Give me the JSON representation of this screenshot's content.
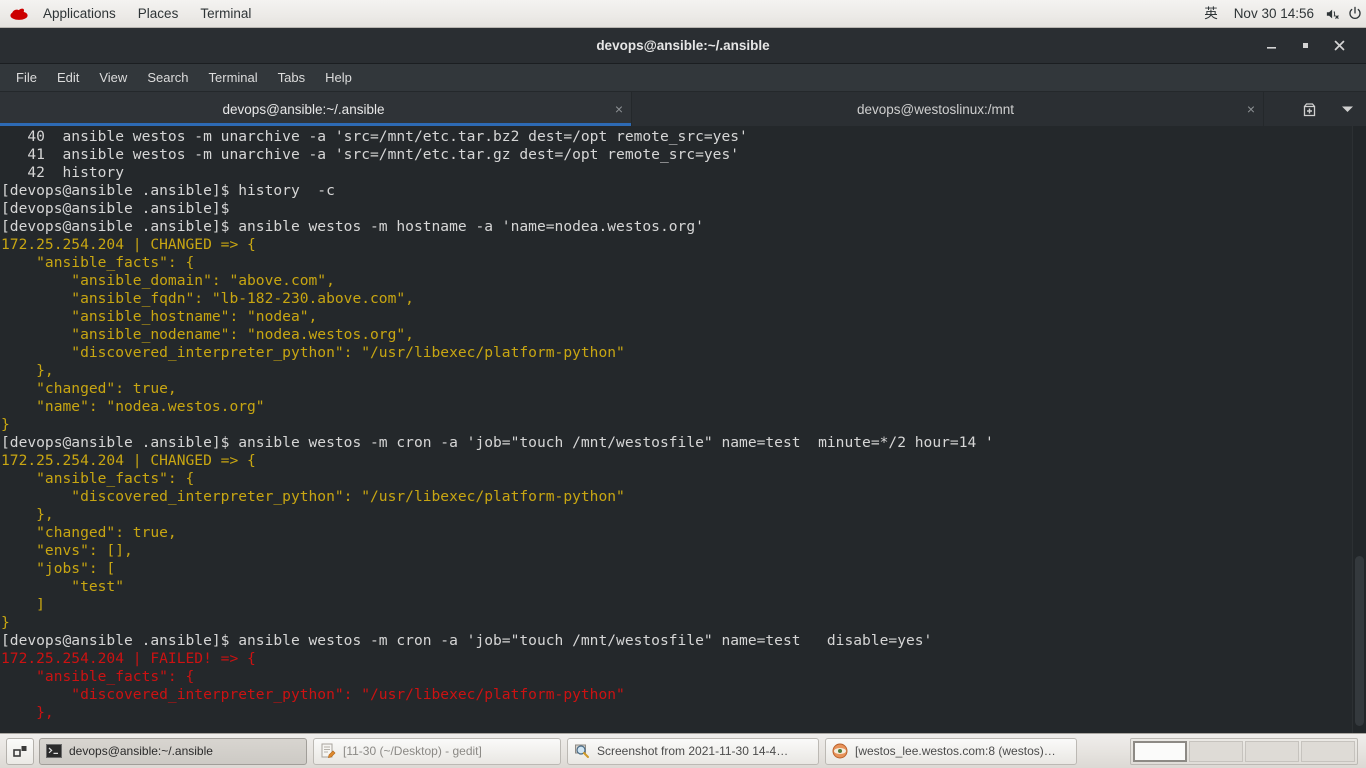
{
  "top_panel": {
    "logo": "redhat-logo",
    "menus": [
      "Applications",
      "Places",
      "Terminal"
    ],
    "input_method": "英",
    "clock": "Nov 30  14:56",
    "volume_icon": "speaker-muted-icon",
    "power_icon": "power-icon"
  },
  "window": {
    "title": "devops@ansible:~/.ansible",
    "controls": {
      "minimize": "minimize-icon",
      "maximize": "maximize-icon",
      "close": "close-icon"
    },
    "menubar": [
      "File",
      "Edit",
      "View",
      "Search",
      "Terminal",
      "Tabs",
      "Help"
    ],
    "tabs": [
      {
        "label": "devops@ansible:~/.ansible",
        "active": true,
        "close": "×"
      },
      {
        "label": "devops@westoslinux:/mnt",
        "active": false,
        "close": "×"
      }
    ],
    "tab_actions": {
      "new_tab": "new-tab-icon",
      "tab_list": "chevron-down-icon"
    }
  },
  "terminal": {
    "colors": {
      "background": "#24282b",
      "text": "#d6d6d6",
      "changed": "#c8a612",
      "failed": "#cc1212"
    },
    "lines": [
      {
        "color": "white",
        "text": "   40  ansible westos -m unarchive -a 'src=/mnt/etc.tar.bz2 dest=/opt remote_src=yes'"
      },
      {
        "color": "white",
        "text": "   41  ansible westos -m unarchive -a 'src=/mnt/etc.tar.gz dest=/opt remote_src=yes'"
      },
      {
        "color": "white",
        "text": "   42  history"
      },
      {
        "color": "white",
        "text": "[devops@ansible .ansible]$ history  -c"
      },
      {
        "color": "white",
        "text": "[devops@ansible .ansible]$"
      },
      {
        "color": "white",
        "text": "[devops@ansible .ansible]$ ansible westos -m hostname -a 'name=nodea.westos.org'"
      },
      {
        "color": "yellow",
        "text": "172.25.254.204 | CHANGED => {"
      },
      {
        "color": "yellow",
        "text": "    \"ansible_facts\": {"
      },
      {
        "color": "yellow",
        "text": "        \"ansible_domain\": \"above.com\","
      },
      {
        "color": "yellow",
        "text": "        \"ansible_fqdn\": \"lb-182-230.above.com\","
      },
      {
        "color": "yellow",
        "text": "        \"ansible_hostname\": \"nodea\","
      },
      {
        "color": "yellow",
        "text": "        \"ansible_nodename\": \"nodea.westos.org\","
      },
      {
        "color": "yellow",
        "text": "        \"discovered_interpreter_python\": \"/usr/libexec/platform-python\""
      },
      {
        "color": "yellow",
        "text": "    },"
      },
      {
        "color": "yellow",
        "text": "    \"changed\": true,"
      },
      {
        "color": "yellow",
        "text": "    \"name\": \"nodea.westos.org\""
      },
      {
        "color": "yellow",
        "text": "}"
      },
      {
        "color": "white",
        "text": "[devops@ansible .ansible]$ ansible westos -m cron -a 'job=\"touch /mnt/westosfile\" name=test  minute=*/2 hour=14 '"
      },
      {
        "color": "yellow",
        "text": "172.25.254.204 | CHANGED => {"
      },
      {
        "color": "yellow",
        "text": "    \"ansible_facts\": {"
      },
      {
        "color": "yellow",
        "text": "        \"discovered_interpreter_python\": \"/usr/libexec/platform-python\""
      },
      {
        "color": "yellow",
        "text": "    },"
      },
      {
        "color": "yellow",
        "text": "    \"changed\": true,"
      },
      {
        "color": "yellow",
        "text": "    \"envs\": [],"
      },
      {
        "color": "yellow",
        "text": "    \"jobs\": ["
      },
      {
        "color": "yellow",
        "text": "        \"test\""
      },
      {
        "color": "yellow",
        "text": "    ]"
      },
      {
        "color": "yellow",
        "text": "}"
      },
      {
        "color": "white",
        "text": "[devops@ansible .ansible]$ ansible westos -m cron -a 'job=\"touch /mnt/westosfile\" name=test   disable=yes'"
      },
      {
        "color": "red",
        "text": "172.25.254.204 | FAILED! => {"
      },
      {
        "color": "red",
        "text": "    \"ansible_facts\": {"
      },
      {
        "color": "red",
        "text": "        \"discovered_interpreter_python\": \"/usr/libexec/platform-python\""
      },
      {
        "color": "red",
        "text": "    },"
      }
    ]
  },
  "taskbar": {
    "show_desktop": "show-desktop-icon",
    "tasks": [
      {
        "label": "devops@ansible:~/.ansible",
        "icon": "terminal-icon",
        "active": true
      },
      {
        "label": "[11-30 (~/Desktop) - gedit]",
        "icon": "gedit-icon",
        "active": false
      },
      {
        "label": "Screenshot from 2021-11-30 14-4…",
        "icon": "screenshot-icon",
        "active": false
      },
      {
        "label": "[westos_lee.westos.com:8 (westos)…",
        "icon": "browser-icon",
        "active": false
      }
    ],
    "workspaces": [
      {
        "name": "workspace-1",
        "active": true
      },
      {
        "name": "workspace-2",
        "active": false
      },
      {
        "name": "workspace-3",
        "active": false
      },
      {
        "name": "workspace-4",
        "active": false
      }
    ]
  }
}
